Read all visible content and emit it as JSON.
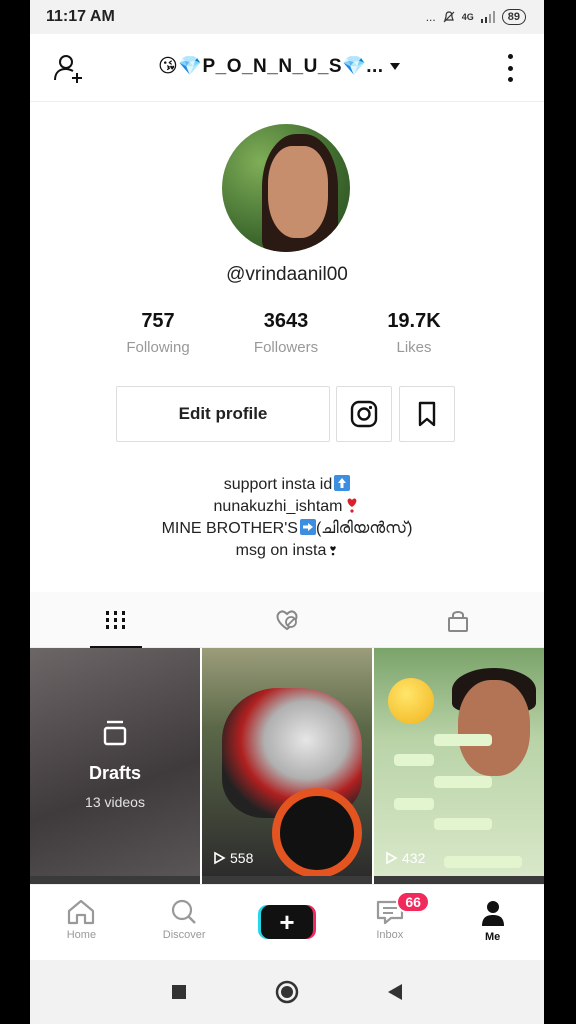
{
  "status_bar": {
    "time": "11:17 AM",
    "indicators": "... ",
    "network": "4G",
    "battery": "89"
  },
  "header": {
    "title": "😘💎P_O_N_N_U_S💎...",
    "add_user_icon": "person-add-icon",
    "more_icon": "vertical-dots-icon"
  },
  "profile": {
    "handle": "@vrindaanil00",
    "stats": [
      {
        "value": "757",
        "label": "Following"
      },
      {
        "value": "3643",
        "label": "Followers"
      },
      {
        "value": "19.7K",
        "label": "Likes"
      }
    ],
    "edit_label": "Edit profile",
    "bio": [
      "support insta id",
      "nunakuzhi_ishtam",
      "MINE BROTHER'S",
      "(ചിരിയൻസ്)",
      "msg on insta"
    ]
  },
  "tabs": [
    {
      "icon": "grid-icon",
      "active": true
    },
    {
      "icon": "liked-hidden-icon",
      "active": false
    },
    {
      "icon": "lock-icon",
      "active": false
    }
  ],
  "videos": {
    "drafts_title": "Drafts",
    "drafts_count": "13 videos",
    "views": [
      "558",
      "432"
    ]
  },
  "bottom_nav": {
    "items": [
      "Home",
      "Discover",
      "Inbox",
      "Me"
    ],
    "inbox_badge": "66"
  },
  "colors": {
    "accent_red": "#f2295b",
    "accent_cyan": "#27d7e8"
  }
}
